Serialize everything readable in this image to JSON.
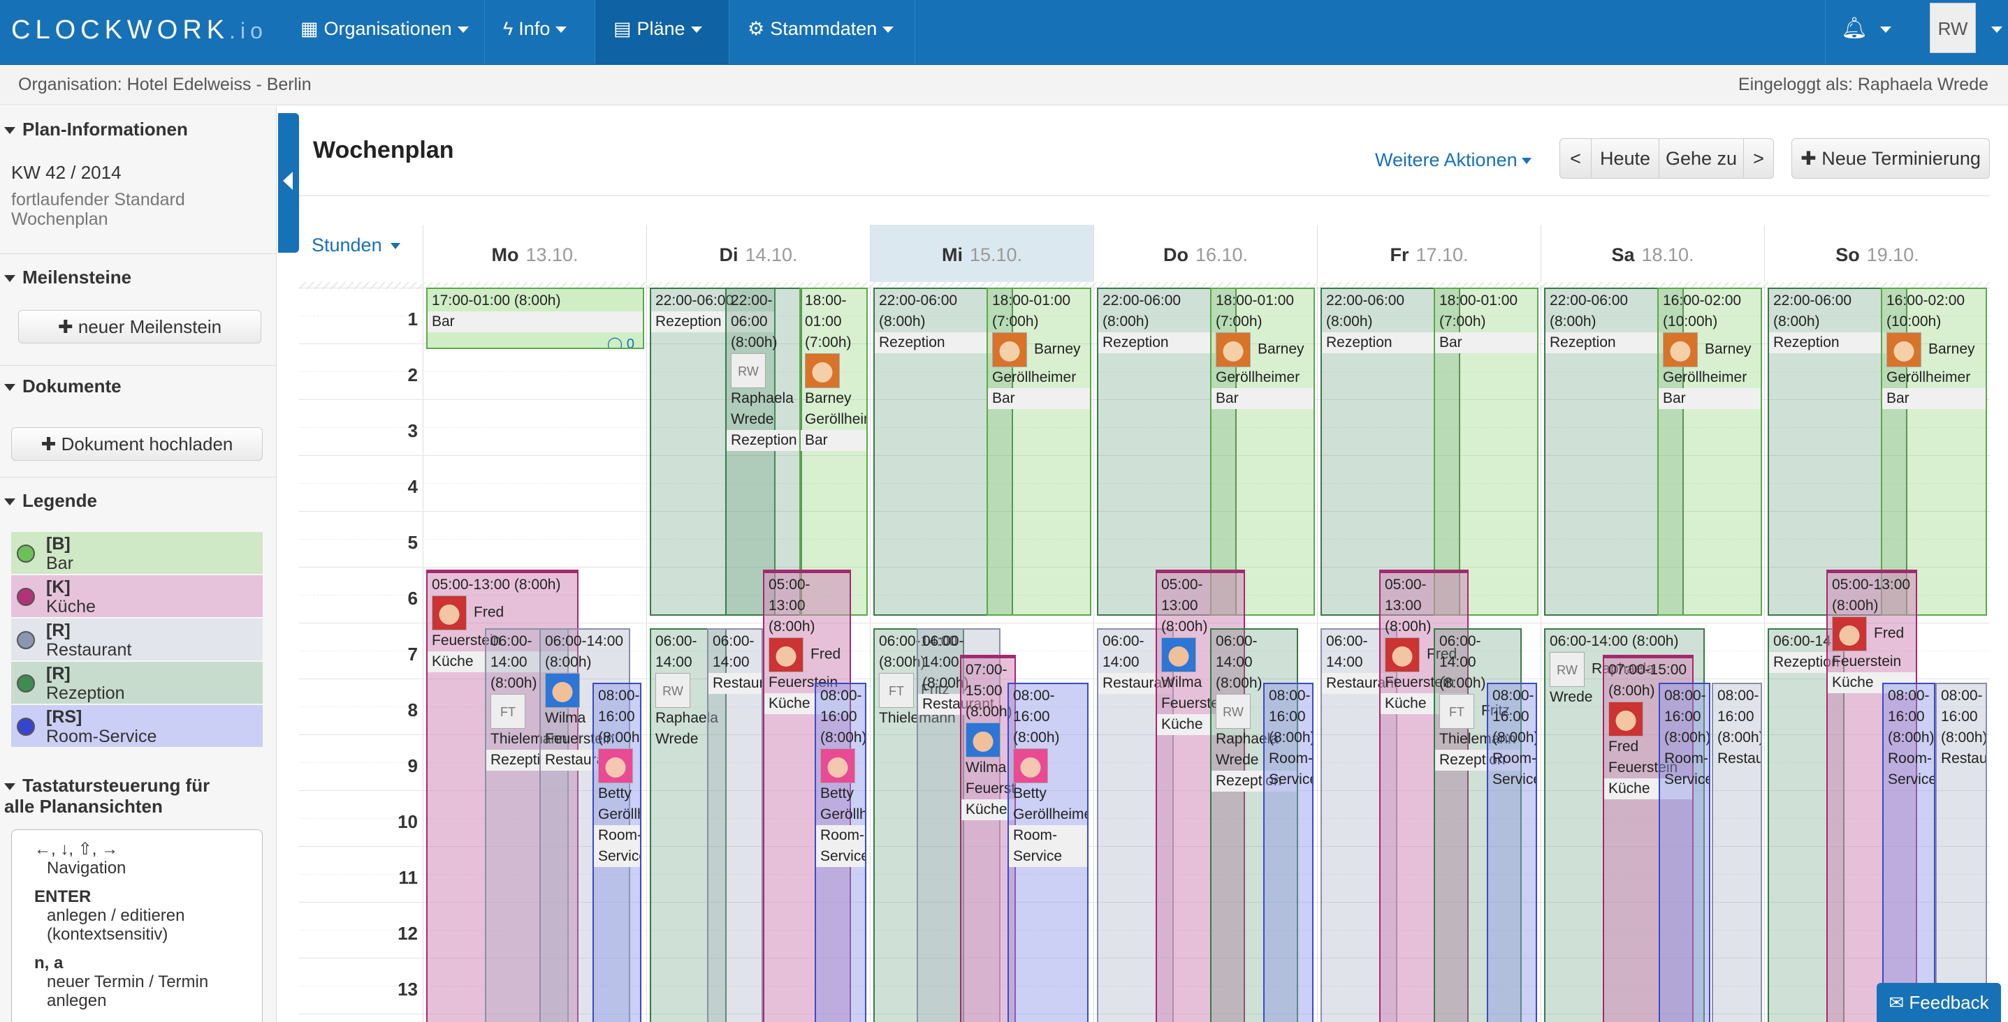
{
  "brand": {
    "logo": "CLOCKWORK",
    "logo_suffix": ".io"
  },
  "nav": [
    {
      "label": "Organisationen",
      "icon": "sitemap-icon"
    },
    {
      "label": "Info",
      "icon": "bolt-icon"
    },
    {
      "label": "Pläne",
      "icon": "calendar-icon"
    },
    {
      "label": "Stammdaten",
      "icon": "gear-icon"
    }
  ],
  "user": {
    "initials": "RW"
  },
  "subbar": {
    "org": "Organisation: Hotel Edelweiss - Berlin",
    "login": "Eingeloggt als: Raphaela Wrede"
  },
  "sidebar": {
    "plan_title": "Plan-Informationen",
    "kw": "KW 42 / 2014",
    "plan_desc": "fortlaufender Standard Wochenplan",
    "milestones_title": "Meilensteine",
    "milestone_btn": "neuer Meilenstein",
    "docs_title": "Dokumente",
    "docs_btn": "Dokument hochladen",
    "legend_title": "Legende",
    "legend": [
      {
        "code": "[B]",
        "name": "Bar",
        "color": "#9ed68f",
        "dot": "#6cc05a"
      },
      {
        "code": "[K]",
        "name": "Küche",
        "color": "#e2b8d4",
        "dot": "#b0337a"
      },
      {
        "code": "[R]",
        "name": "Restaurant",
        "color": "#dfe2ea",
        "dot": "#8d96b0"
      },
      {
        "code": "[R]",
        "name": "Rezeption",
        "color": "#c8dccd",
        "dot": "#3f8c52"
      },
      {
        "code": "[RS]",
        "name": "Room-Service",
        "color": "#c9cdf3",
        "dot": "#3545d1"
      }
    ],
    "kb_title": "Tastatursteuerung für alle Planansichten",
    "kb_arrows": "←, ↓, ⇧, →",
    "kb_nav": "Navigation",
    "kb_enter": "ENTER",
    "kb_enter_desc": "anlegen / editieren (kontextsensitiv)",
    "kb_na": "n, a",
    "kb_na_desc": "neuer Termin / Termin anlegen"
  },
  "main": {
    "title": "Wochenplan",
    "more_actions": "Weitere Aktionen",
    "prev": "<",
    "today": "Heute",
    "goto": "Gehe zu",
    "next": ">",
    "new_btn": "Neue Terminierung",
    "hours_label": "Stunden"
  },
  "days": [
    {
      "name": "Mo",
      "date": "13.10."
    },
    {
      "name": "Di",
      "date": "14.10."
    },
    {
      "name": "Mi",
      "date": "15.10."
    },
    {
      "name": "Do",
      "date": "16.10."
    },
    {
      "name": "Fr",
      "date": "17.10."
    },
    {
      "name": "Sa",
      "date": "18.10."
    },
    {
      "name": "So",
      "date": "19.10."
    }
  ],
  "hours": [
    "1",
    "2",
    "3",
    "4",
    "5",
    "6",
    "7",
    "8",
    "9",
    "10",
    "11",
    "12",
    "13"
  ],
  "events": {
    "mo_bar_time": "17:00-01:00 (8:00h)",
    "mo_bar_loc": "Bar",
    "mo_k_time": "05:00-13:00 (8:00h)",
    "mo_k_name": "Fred Feuerstein",
    "mo_k_loc": "Küche",
    "mo_r_time": "06:00-14:00 (8:00h)",
    "mo_r_init": "FT",
    "mo_r_name": "Thielemann",
    "mo_r_loc": "Rezeption",
    "mo_res_time": "06:00-14:00 (8:00h)",
    "mo_res_name": "Wilma Feuerstein",
    "mo_res_loc": "Restaurant",
    "mo_rs_time": "08:00-16:00 (8:00h)",
    "mo_rs_name": "Betty Geröllheimer",
    "mo_rs_loc": "Room-Service",
    "di_r_time": "22:00-06:00",
    "di_r_loc": "Rezeption",
    "di_r2_time": "22:00-06:00 (8:00h)",
    "di_r2_init": "RW",
    "di_r2_name": "Raphaela Wrede",
    "di_r2_loc": "Rezeption",
    "di_b_time": "18:00-01:00 (7:00h)",
    "di_b_name": "Barney Geröllheimer",
    "di_b_loc": "Bar",
    "di_k_time": "05:00-13:00 (8:00h)",
    "di_k_name": "Fred Feuerstein",
    "di_k_loc": "Küche",
    "di_rz_time": "06:00-14:00",
    "di_rz_init": "RW",
    "di_rz_name": "Raphaela Wrede",
    "di_res_time": "06:00-14:00",
    "di_res_loc": "Restaurant",
    "di_rs_time": "08:00-16:00 (8:00h)",
    "di_rs_name": "Betty Geröllheimer",
    "di_rs_loc": "Room-Service",
    "mi_r_time": "22:00-06:00 (8:00h)",
    "mi_r_loc": "Rezeption",
    "mi_b_time": "18:00-01:00 (7:00h)",
    "mi_b_name": "Barney Geröllheimer",
    "mi_b_loc": "Bar",
    "mi_rz_time": "06:00-14:00 (8:00h)",
    "mi_rz_init": "FT",
    "mi_rz_name": "Fritz Thielemann",
    "mi_res_time": "06:00-14:00 (8:00h)",
    "mi_res_loc": "Restaurant",
    "mi_k_time": "07:00-15:00 (8:00h)",
    "mi_k_name": "Wilma Feuerstein",
    "mi_k_loc": "Küche",
    "mi_rs_time": "08:00-16:00 (8:00h)",
    "mi_rs_name": "Betty Geröllheimer",
    "mi_rs_loc": "Room-Service",
    "do_r_time": "22:00-06:00 (8:00h)",
    "do_r_loc": "Rezeption",
    "do_b_time": "18:00-01:00 (7:00h)",
    "do_b_name": "Barney Geröllheimer",
    "do_b_loc": "Bar",
    "do_k_time": "05:00-13:00 (8:00h)",
    "do_k_name": "Wilma Feuerstein",
    "do_k_loc": "Küche",
    "do_res_time": "06:00-14:00",
    "do_res_loc": "Restaurant",
    "do_rz_time": "06:00-14:00 (8:00h)",
    "do_rz_init": "RW",
    "do_rz_name": "Raphaela Wrede",
    "do_rz_loc": "Rezeption",
    "do_rs_time": "08:00-16:00 (8:00h)",
    "do_rs_loc": "Room-Service",
    "fr_r_time": "22:00-06:00 (8:00h)",
    "fr_r_loc": "Rezeption",
    "fr_b_time": "18:00-01:00 (7:00h)",
    "fr_b_loc": "Bar",
    "fr_res_time": "06:00-14:00",
    "fr_res_loc": "Restaurant",
    "fr_k_time": "05:00-13:00 (8:00h)",
    "fr_k_name": "Fred Feuerstein",
    "fr_k_loc": "Küche",
    "fr_rz_time": "06:00-14:00 (8:00h)",
    "fr_rz_init": "FT",
    "fr_rz_name": "Fritz Thielemann",
    "fr_rz_loc": "Rezeption",
    "fr_rs_time": "08:00-16:00 (8:00h)",
    "fr_rs_loc": "Room-Service",
    "sa_r_time": "22:00-06:00 (8:00h)",
    "sa_r_loc": "Rezeption",
    "sa_b_time": "16:00-02:00 (10:00h)",
    "sa_b_name": "Barney Geröllheimer",
    "sa_b_loc": "Bar",
    "sa_rz_time": "06:00-14:00 (8:00h)",
    "sa_rz_init": "RW",
    "sa_rz_name": "Raphaela Wrede",
    "sa_k_time": "07:00-15:00 (8:00h)",
    "sa_k_name": "Fred Feuerstein",
    "sa_k_loc": "Küche",
    "sa_rs_time": "08:00-16:00 (8:00h)",
    "sa_rs_loc": "Room-Service",
    "sa_res_time": "08:00-16:00 (8:00h)",
    "sa_res_loc": "Restaurant",
    "so_r_time": "22:00-06:00 (8:00h)",
    "so_r_loc": "Rezeption",
    "so_b_time": "16:00-02:00 (10:00h)",
    "so_b_name": "Barney Geröllheimer",
    "so_b_loc": "Bar",
    "so_k_time": "05:00-13:00 (8:00h)",
    "so_k_name": "Fred Feuerstein",
    "so_k_loc": "Küche",
    "so_rz_time": "06:00-14",
    "so_rz_loc": "Rezeption",
    "so_rs_time": "08:00-16:00 (8:00h)",
    "so_rs_loc": "Room-Service",
    "so_res_time": "08:00-16:00 (8:00h)",
    "so_res_loc": "Restaurant",
    "comment": "0"
  },
  "feedback": "Feedback"
}
